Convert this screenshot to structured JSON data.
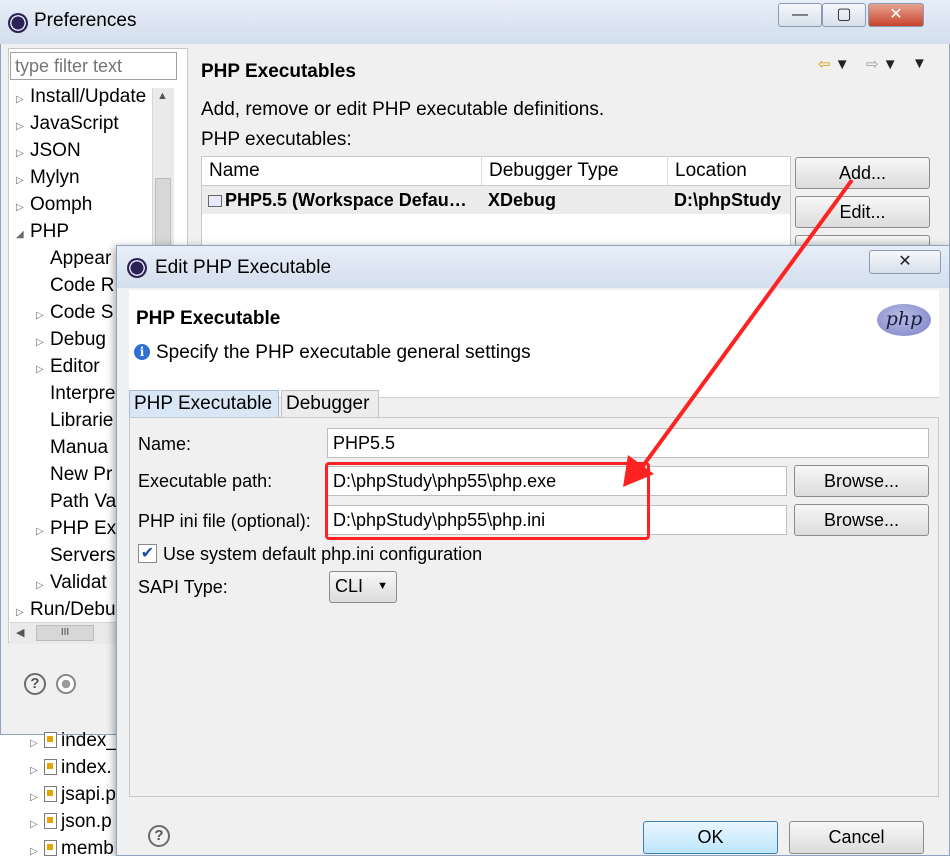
{
  "preferences": {
    "title": "Preferences",
    "filter_placeholder": "type filter text",
    "tree_items": [
      {
        "label": "Install/Update",
        "indent": 0,
        "arrow": "collapsed"
      },
      {
        "label": "JavaScript",
        "indent": 0,
        "arrow": "collapsed"
      },
      {
        "label": "JSON",
        "indent": 0,
        "arrow": "collapsed"
      },
      {
        "label": "Mylyn",
        "indent": 0,
        "arrow": "collapsed"
      },
      {
        "label": "Oomph",
        "indent": 0,
        "arrow": "collapsed"
      },
      {
        "label": "PHP",
        "indent": 0,
        "arrow": "expanded"
      },
      {
        "label": "Appear",
        "indent": 1,
        "arrow": "none"
      },
      {
        "label": "Code R",
        "indent": 1,
        "arrow": "none"
      },
      {
        "label": "Code S",
        "indent": 1,
        "arrow": "collapsed"
      },
      {
        "label": "Debug",
        "indent": 1,
        "arrow": "collapsed"
      },
      {
        "label": "Editor",
        "indent": 1,
        "arrow": "collapsed"
      },
      {
        "label": "Interpre",
        "indent": 1,
        "arrow": "none"
      },
      {
        "label": "Librarie",
        "indent": 1,
        "arrow": "none"
      },
      {
        "label": "Manua",
        "indent": 1,
        "arrow": "none"
      },
      {
        "label": "New Pr",
        "indent": 1,
        "arrow": "none"
      },
      {
        "label": "Path Va",
        "indent": 1,
        "arrow": "none"
      },
      {
        "label": "PHP Ex",
        "indent": 1,
        "arrow": "collapsed"
      },
      {
        "label": "Servers",
        "indent": 1,
        "arrow": "none"
      },
      {
        "label": "Validat",
        "indent": 1,
        "arrow": "collapsed"
      },
      {
        "label": "Run/Debu",
        "indent": 0,
        "arrow": "collapsed"
      }
    ],
    "scroll_grip": "III",
    "page_title": "PHP Executables",
    "description": "Add, remove or edit PHP executable definitions.",
    "list_label": "PHP executables:",
    "table": {
      "columns": [
        "Name",
        "Debugger Type",
        "Location"
      ],
      "rows": [
        [
          "PHP5.5 (Workspace Defau…",
          "XDebug",
          "D:\\phpStudy"
        ]
      ]
    },
    "buttons": {
      "add": "Add...",
      "edit": "Edit..."
    },
    "project_files": [
      "index_",
      "index.",
      "jsapi.p",
      "json.p",
      "memb"
    ]
  },
  "dialog": {
    "title": "Edit PHP Executable",
    "close_glyph": "✕",
    "banner_title": "PHP Executable",
    "banner_subtitle": "Specify the PHP executable general settings",
    "info_glyph": "i",
    "logo_text": "php",
    "tabs": [
      "PHP Executable",
      "Debugger"
    ],
    "name_label": "Name:",
    "name_value": "PHP5.5",
    "exe_label": "Executable path:",
    "exe_value": "D:\\phpStudy\\php55\\php.exe",
    "ini_label": "PHP ini file (optional):",
    "ini_value": "D:\\phpStudy\\php55\\php.ini",
    "browse_label": "Browse...",
    "checkbox_label": "Use system default php.ini configuration",
    "checkbox_checked": true,
    "sapi_label": "SAPI Type:",
    "sapi_value": "CLI",
    "ok_label": "OK",
    "cancel_label": "Cancel"
  },
  "colors": {
    "annotation": "#ff2222",
    "title_bar": "#d3deed",
    "ok_border": "#3c7fb1"
  }
}
